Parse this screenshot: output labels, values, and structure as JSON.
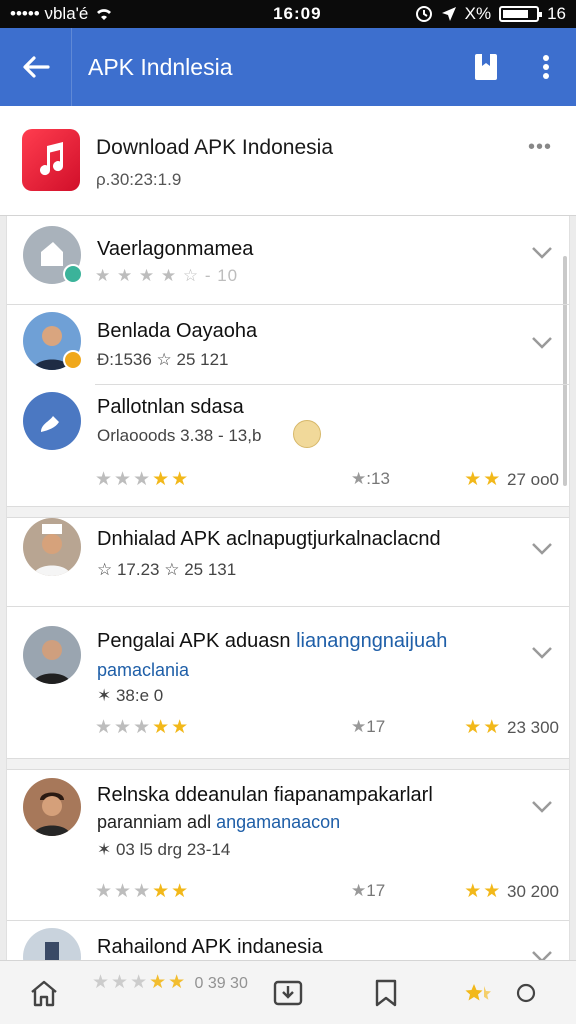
{
  "status_bar": {
    "carrier": "••••• νbla'é",
    "time": "16:09",
    "battery_text": "X%",
    "extra": "16"
  },
  "app_bar": {
    "title": "APK Indnlesia"
  },
  "app_card": {
    "name": "Download APK Indonesia",
    "version": "ρ.30:23:1.9"
  },
  "items": [
    {
      "name": "Vaerlagonmamea",
      "rating_text": "★ ★ ★ ★ ☆ - 10"
    },
    {
      "name": "Benlada Oayaoha",
      "meta": "Ð:1536 ☆ 25 121"
    },
    {
      "name": "Pallotnlan sdasa",
      "meta": "Orlaooods 3.38 - 13,b",
      "mid": "13",
      "right": "27 oo0"
    },
    {
      "name": "Dnhialad APK aclnapugtjurkalnaclacnd",
      "meta": "☆ 17.23 ☆ 25 131"
    },
    {
      "name": "Pengalai APK aduasn",
      "name_link": "lianangngnaijuah",
      "sub_link": "pamaclania",
      "meta": "✶ 38:e 0",
      "mid": "17",
      "right": "23 300"
    },
    {
      "name": "Relnska ddeanulan fiapanampakarlarl",
      "sub_plain": "paranniam adl",
      "sub_link": "angamanaacon",
      "meta": "✶ 03 l5 drg 23-14",
      "mid": "17",
      "right": "30 200"
    },
    {
      "name": "Rahailond APK indanesia",
      "meta": "0 39 30"
    }
  ],
  "colors": {
    "app_bar": "#3d6fce",
    "star_on": "#f2b81a",
    "link": "#1f5fa8"
  },
  "icons": [
    "back-arrow-icon",
    "bookmark-icon",
    "more-vertical-icon",
    "more-horizontal-icon",
    "chevron-down-icon",
    "home-icon",
    "download-icon",
    "bookmark-outline-icon",
    "circle-icon"
  ]
}
